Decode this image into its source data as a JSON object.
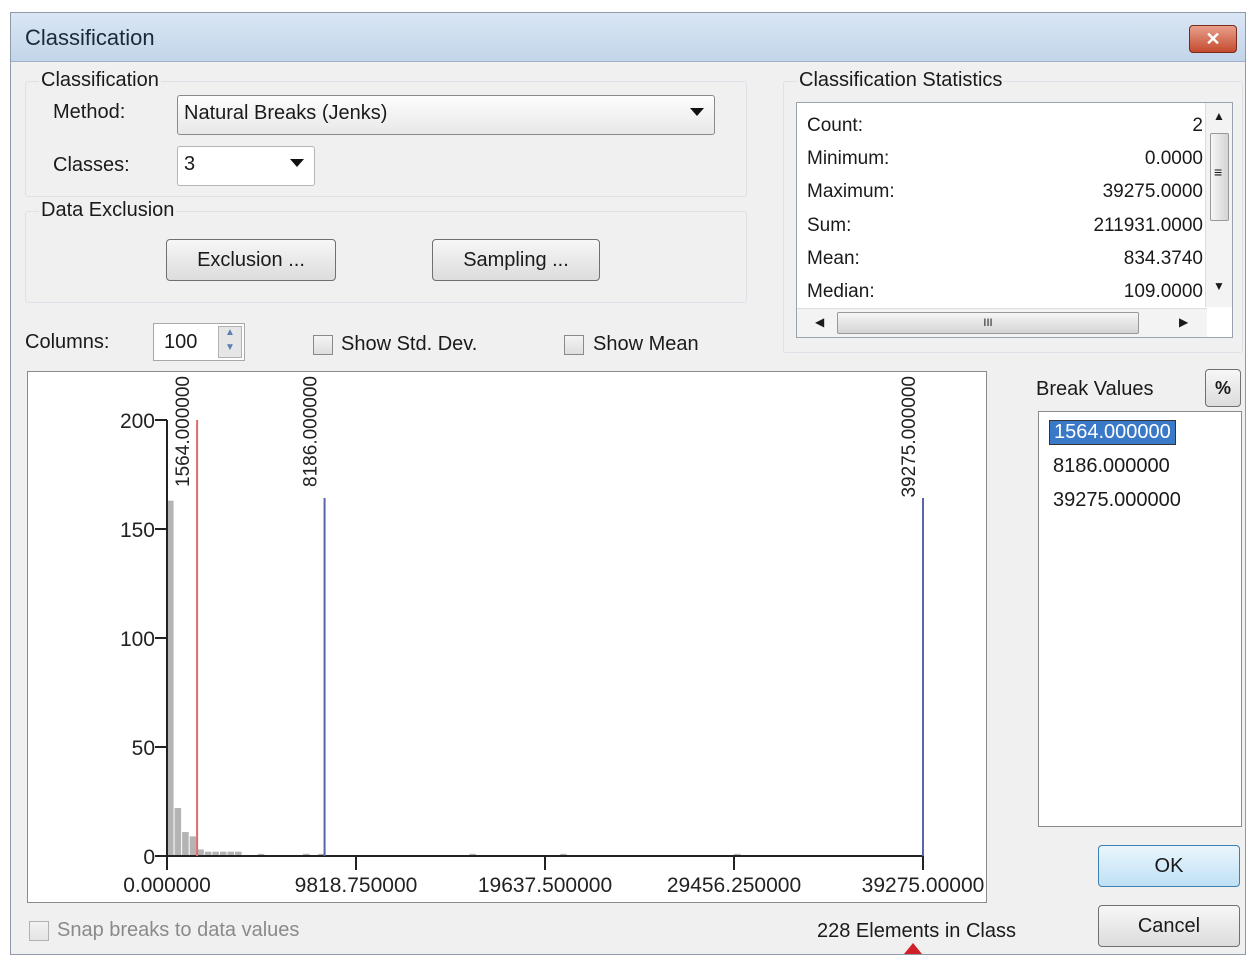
{
  "window": {
    "title": "Classification",
    "close_label": "✕"
  },
  "classification_group": {
    "label": "Classification",
    "method_label": "Method:",
    "method_value": "Natural Breaks (Jenks)",
    "classes_label": "Classes:",
    "classes_value": "3"
  },
  "exclusion_group": {
    "label": "Data Exclusion",
    "exclusion_button": "Exclusion ...",
    "sampling_button": "Sampling ..."
  },
  "statistics": {
    "label": "Classification Statistics",
    "rows": [
      {
        "key": "Count:",
        "value": "2"
      },
      {
        "key": "Minimum:",
        "value": "0.0000"
      },
      {
        "key": "Maximum:",
        "value": "39275.0000"
      },
      {
        "key": "Sum:",
        "value": "211931.0000"
      },
      {
        "key": "Mean:",
        "value": "834.3740"
      },
      {
        "key": "Median:",
        "value": "109.0000"
      }
    ],
    "hscroll_grip": "III",
    "vscroll_grip": "≡"
  },
  "columns": {
    "label": "Columns:",
    "value": "100"
  },
  "show_std_dev": {
    "label": "Show Std. Dev.",
    "checked": false
  },
  "show_mean": {
    "label": "Show Mean",
    "checked": false
  },
  "chart_data": {
    "type": "bar",
    "xlabel": "",
    "ylabel": "",
    "xlim": [
      0,
      39275
    ],
    "ylim": [
      0,
      200
    ],
    "y_ticks": [
      0,
      50,
      100,
      150,
      200
    ],
    "x_ticks": [
      0,
      9818.75,
      19637.5,
      29456.25,
      39275
    ],
    "x_tick_labels": [
      "0.000000",
      "9818.750000",
      "19637.500000",
      "29456.250000",
      "39275.00000"
    ],
    "y_tick_labels": [
      "0",
      "50",
      "100",
      "150",
      "200"
    ],
    "bar_width": 392.75,
    "bars": [
      {
        "x": 0,
        "value": 163
      },
      {
        "x": 392.75,
        "value": 22
      },
      {
        "x": 785.5,
        "value": 11
      },
      {
        "x": 1178.25,
        "value": 9
      },
      {
        "x": 1571,
        "value": 3
      },
      {
        "x": 1963.75,
        "value": 2
      },
      {
        "x": 2356.5,
        "value": 2
      },
      {
        "x": 2749.25,
        "value": 2
      },
      {
        "x": 3142,
        "value": 2
      },
      {
        "x": 3534.75,
        "value": 2
      },
      {
        "x": 4712.25,
        "value": 1
      },
      {
        "x": 7069,
        "value": 1
      },
      {
        "x": 7854.5,
        "value": 1
      },
      {
        "x": 15710,
        "value": 1
      },
      {
        "x": 20422,
        "value": 1
      },
      {
        "x": 29456.25,
        "value": 1
      }
    ],
    "breaks": [
      {
        "value": 1564,
        "label": "1564.000000",
        "color": "#e06a6a",
        "selected": true
      },
      {
        "value": 8186,
        "label": "8186.000000",
        "color": "#5a64a8",
        "selected": false
      },
      {
        "value": 39275,
        "label": "39275.000000",
        "color": "#5a64a8",
        "selected": false
      }
    ],
    "bar_color": "#b4b4b4"
  },
  "break_values": {
    "label": "Break Values",
    "percent_button": "%",
    "items": [
      "1564.000000",
      "8186.000000",
      "39275.000000"
    ]
  },
  "snap_breaks": {
    "label": "Snap breaks to data values",
    "enabled": false
  },
  "elements_in_class": "228 Elements in Class",
  "ok_button": "OK",
  "cancel_button": "Cancel"
}
